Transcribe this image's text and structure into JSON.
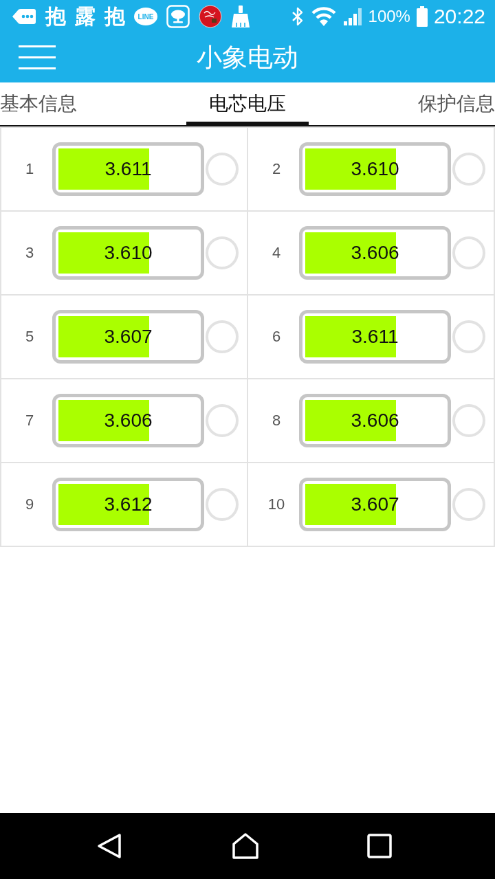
{
  "status_bar": {
    "app_glyphs": [
      "抱",
      "露",
      "抱"
    ],
    "chat_badge": "LINE",
    "battery": "100%",
    "time": "20:22"
  },
  "app_bar": {
    "title": "小象电动"
  },
  "tabs": [
    {
      "label": "基本信息",
      "selected": false
    },
    {
      "label": "电芯电压",
      "selected": true
    },
    {
      "label": "保护信息",
      "selected": false
    }
  ],
  "cells": [
    {
      "number": "1",
      "voltage": "3.611",
      "level": 0.65,
      "balancing": false
    },
    {
      "number": "2",
      "voltage": "3.610",
      "level": 0.65,
      "balancing": false
    },
    {
      "number": "3",
      "voltage": "3.610",
      "level": 0.65,
      "balancing": false
    },
    {
      "number": "4",
      "voltage": "3.606",
      "level": 0.65,
      "balancing": false
    },
    {
      "number": "5",
      "voltage": "3.607",
      "level": 0.65,
      "balancing": false
    },
    {
      "number": "6",
      "voltage": "3.611",
      "level": 0.65,
      "balancing": false
    },
    {
      "number": "7",
      "voltage": "3.606",
      "level": 0.65,
      "balancing": false
    },
    {
      "number": "8",
      "voltage": "3.606",
      "level": 0.65,
      "balancing": false
    },
    {
      "number": "9",
      "voltage": "3.612",
      "level": 0.65,
      "balancing": false
    },
    {
      "number": "10",
      "voltage": "3.607",
      "level": 0.65,
      "balancing": false
    }
  ]
}
